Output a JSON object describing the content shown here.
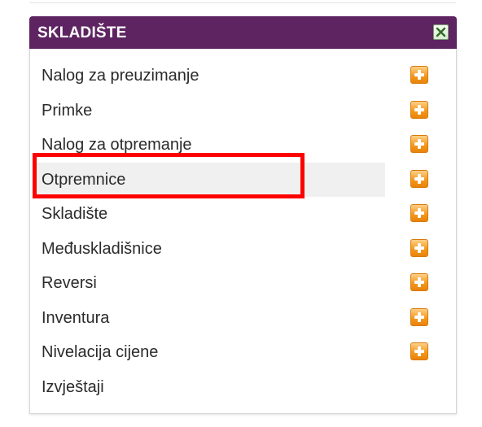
{
  "panel": {
    "title": "SKLADIŠTE",
    "close_icon": "close-icon",
    "header_color": "#5e2462",
    "accent_add_color": "#f39a1d",
    "highlight_color": "#ff0000"
  },
  "menu": {
    "items": [
      {
        "label": "Nalog za preuzimanje",
        "has_add": true,
        "hovered": false,
        "highlighted": false
      },
      {
        "label": "Primke",
        "has_add": true,
        "hovered": false,
        "highlighted": false
      },
      {
        "label": "Nalog za otpremanje",
        "has_add": true,
        "hovered": false,
        "highlighted": false
      },
      {
        "label": "Otpremnice",
        "has_add": true,
        "hovered": true,
        "highlighted": true
      },
      {
        "label": "Skladište",
        "has_add": true,
        "hovered": false,
        "highlighted": false
      },
      {
        "label": "Međuskladišnice",
        "has_add": true,
        "hovered": false,
        "highlighted": false
      },
      {
        "label": "Reversi",
        "has_add": true,
        "hovered": false,
        "highlighted": false
      },
      {
        "label": "Inventura",
        "has_add": true,
        "hovered": false,
        "highlighted": false
      },
      {
        "label": "Nivelacija cijene",
        "has_add": true,
        "hovered": false,
        "highlighted": false
      },
      {
        "label": "Izvještaji",
        "has_add": false,
        "hovered": false,
        "highlighted": false
      }
    ]
  }
}
